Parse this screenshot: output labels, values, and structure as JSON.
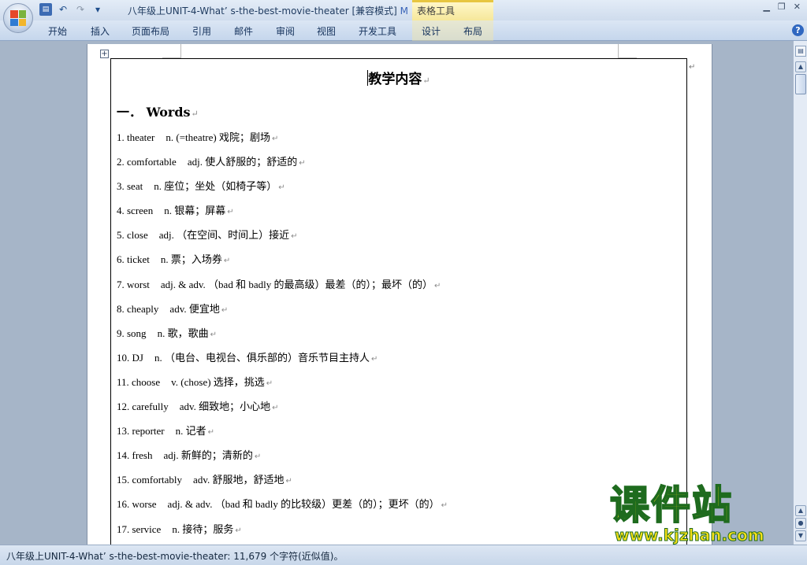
{
  "titlebar": {
    "doc_title": "八年级上UNIT-4-What’ s-the-best-movie-theater [兼容模式] ",
    "title_suffix": "M",
    "context_tab_group": "表格工具",
    "minimize": "▁",
    "restore": "❐",
    "close": "✕"
  },
  "qat": {
    "save_icon": "floppy-disk",
    "undo_icon": "undo-arrow",
    "redo_icon": "redo-arrow",
    "customize_icon": "chevron-down"
  },
  "ribbon": {
    "tabs": [
      "开始",
      "插入",
      "页面布局",
      "引用",
      "邮件",
      "审阅",
      "视图",
      "开发工具",
      "设计",
      "布局"
    ],
    "help": "?"
  },
  "document": {
    "heading": "教学内容",
    "section_title": "一．  Words",
    "paragraph_mark": "↵",
    "vocab": [
      {
        "word": "1. theater",
        "meaning": "n. (=theatre) 戏院；剧场"
      },
      {
        "word": "2. comfortable",
        "meaning": "adj. 使人舒服的；舒适的"
      },
      {
        "word": "3. seat",
        "meaning": "n. 座位；坐处（如椅子等）"
      },
      {
        "word": "4. screen",
        "meaning": "n. 银幕；屏幕"
      },
      {
        "word": "5. close",
        "meaning": "adj. （在空间、时间上）接近"
      },
      {
        "word": "6. ticket",
        "meaning": "n. 票；入场券"
      },
      {
        "word": "7. worst",
        "meaning": "adj. & adv. （bad 和 badly 的最高级）最差（的）；最坏（的）"
      },
      {
        "word": "8. cheaply",
        "meaning": "adv. 便宜地"
      },
      {
        "word": "9. song",
        "meaning": "n. 歌，歌曲"
      },
      {
        "word": "10. DJ",
        "meaning": "n. （电台、电视台、俱乐部的）音乐节目主持人"
      },
      {
        "word": "11. choose",
        "meaning": "v. (chose) 选择，挑选"
      },
      {
        "word": "12. carefully",
        "meaning": "adv. 细致地；小心地"
      },
      {
        "word": "13. reporter",
        "meaning": "n. 记者"
      },
      {
        "word": "14. fresh",
        "meaning": "adj. 新鲜的；清新的"
      },
      {
        "word": "15. comfortably",
        "meaning": "adv. 舒服地，舒适地"
      },
      {
        "word": "16. worse",
        "meaning": "adj. & adv. （bad 和 badly 的比较级）更差（的）；更坏（的）"
      },
      {
        "word": "17. service",
        "meaning": "n. 接待；服务"
      }
    ]
  },
  "statusbar": {
    "text": "八年级上UNIT-4-What’ s-the-best-movie-theater: 11,679 个字符(近似值)。"
  },
  "watermark": {
    "brand": "课件站",
    "url": "www.kjzhan.com"
  },
  "colors": {
    "accent": "#2f67c0",
    "context_tab": "#f6e79a",
    "watermark_fill": "#f7e018",
    "watermark_stroke": "#1e6b1e"
  }
}
